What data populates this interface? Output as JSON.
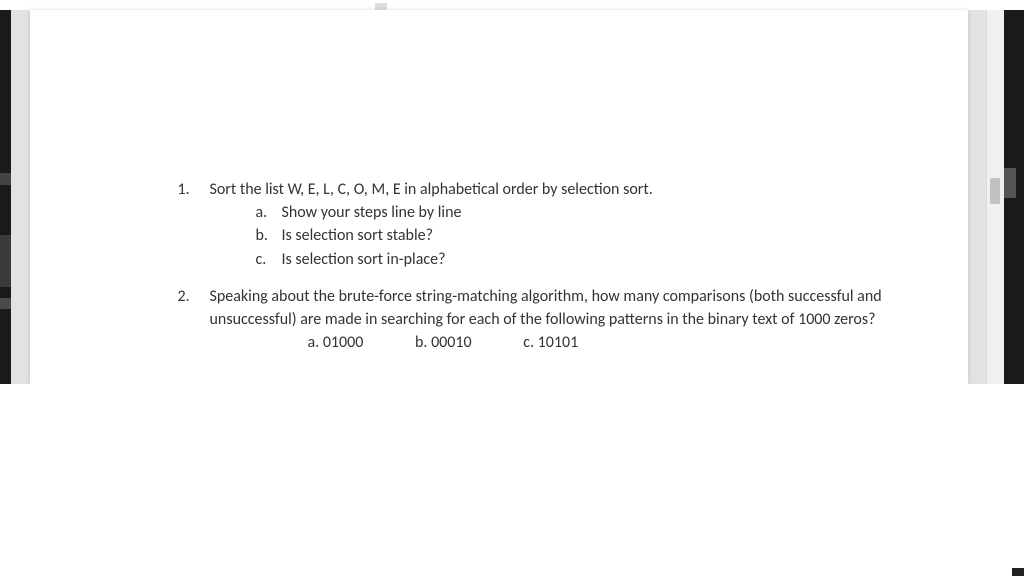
{
  "q1": {
    "marker": "1.",
    "text": "Sort the list W, E, L, C, O, M, E in alphabetical order by selection sort.",
    "subs": {
      "a": {
        "marker": "a.",
        "text": "Show your steps line by line"
      },
      "b": {
        "marker": "b.",
        "text": "Is selection sort stable?"
      },
      "c": {
        "marker": "c.",
        "text": "Is selection sort in-place?"
      }
    }
  },
  "q2": {
    "marker": "2.",
    "text": "Speaking about the brute-force string-matching algorithm, how many comparisons (both successful and unsuccessful) are made in searching for each of the following patterns in the binary text of 1000 zeros?",
    "options": {
      "a": "a. 01000",
      "b": "b. 00010",
      "c": "c. 10101"
    }
  }
}
